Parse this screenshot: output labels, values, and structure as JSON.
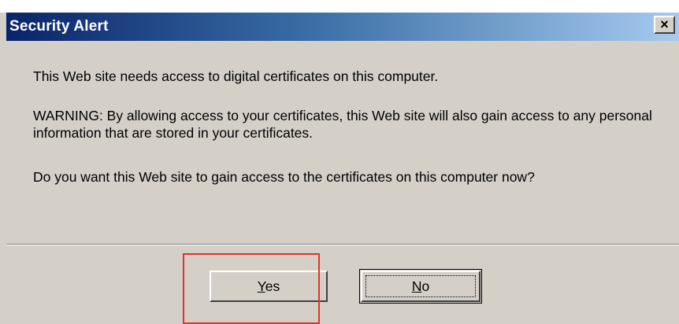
{
  "dialog": {
    "title": "Security Alert",
    "close_symbol": "×",
    "message_line1": "This Web site needs access to digital certificates on this computer.",
    "message_line2": "WARNING: By allowing access to your certificates, this Web site will also gain access to any personal information that are stored in your certificates.",
    "message_line3": "Do you want this Web site to gain access to the certificates on this computer now?",
    "yes_label_mnemonic": "Y",
    "yes_label_rest": "es",
    "no_label_mnemonic": "N",
    "no_label_rest": "o"
  },
  "colors": {
    "title_gradient_start": "#0a246a",
    "title_gradient_end": "#a6caf0",
    "dialog_face": "#d4d0c8",
    "highlight_border": "#e8302a"
  },
  "icons": {
    "close": "close-icon"
  }
}
